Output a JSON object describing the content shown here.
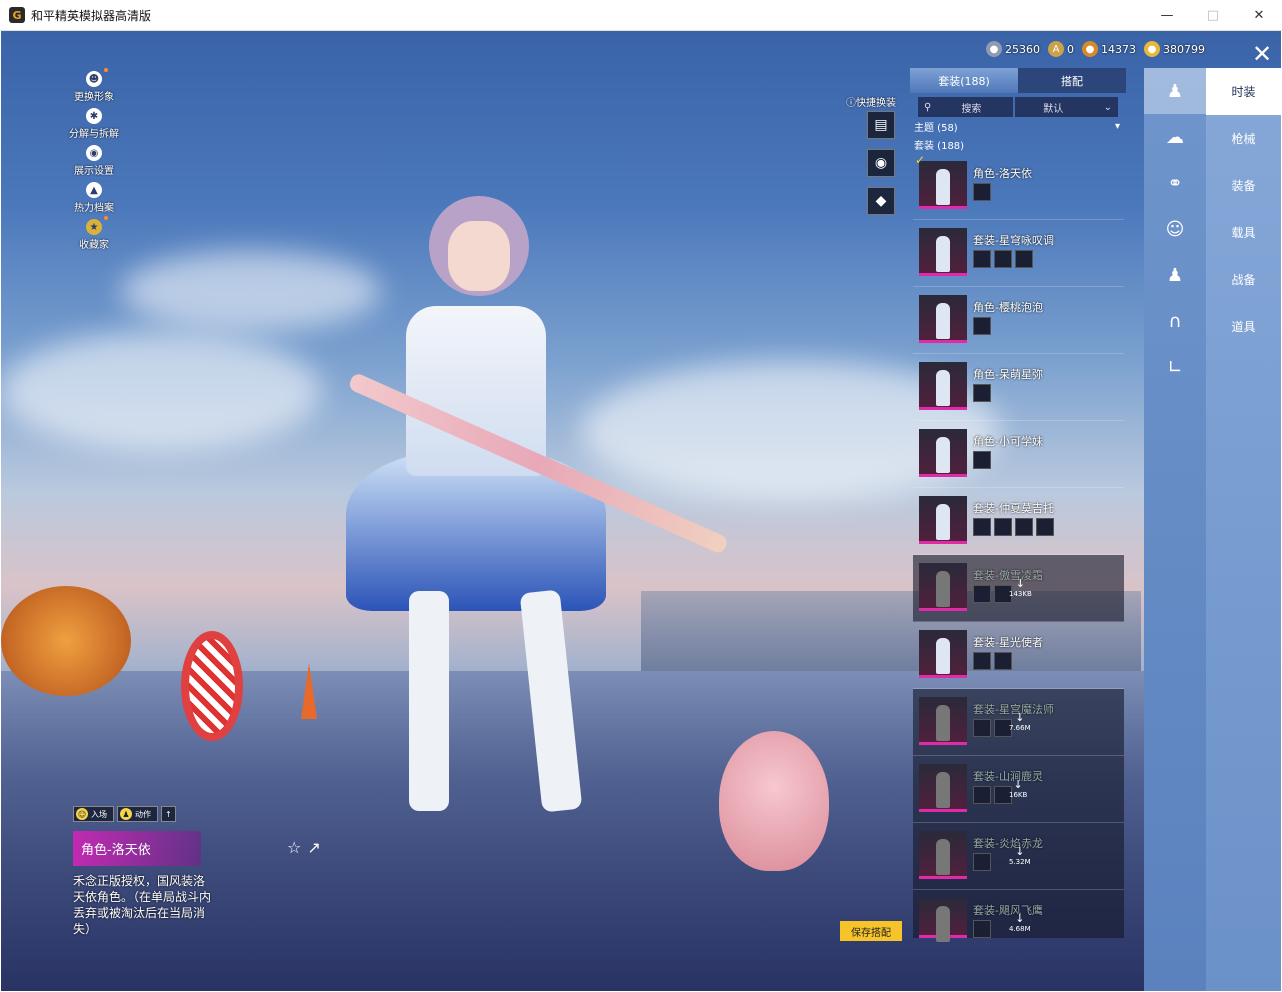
{
  "window": {
    "title": "和平精英模拟器高清版",
    "app_icon": "G"
  },
  "left_menu": [
    {
      "label": "更换形象",
      "icon": "person-icon"
    },
    {
      "label": "分解与拆解",
      "icon": "puzzle-icon"
    },
    {
      "label": "展示设置",
      "icon": "eye-icon"
    },
    {
      "label": "热力档案",
      "icon": "flame-icon"
    },
    {
      "label": "收藏家",
      "icon": "badge-icon"
    }
  ],
  "currency": [
    {
      "value": "25360",
      "color": "#8f9bb0"
    },
    {
      "value": "0",
      "color": "#c9a24a"
    },
    {
      "value": "14373",
      "color": "#d88a2a"
    },
    {
      "value": "380799",
      "color": "#e8b838"
    }
  ],
  "quick_swap_label": "快捷换装",
  "list": {
    "tabs": [
      "套装(188)",
      "搭配"
    ],
    "search_label": "搜索",
    "sort_label": "默认",
    "theme_label": "主题 (58)",
    "set_label": "套装 (188)",
    "items": [
      {
        "name": "角色-洛天依",
        "parts": 1,
        "dim": false,
        "selected": true
      },
      {
        "name": "套装-星穹咏叹调",
        "parts": 3,
        "dim": false
      },
      {
        "name": "角色-樱桃泡泡",
        "parts": 1,
        "dim": false
      },
      {
        "name": "角色-呆萌星弥",
        "parts": 1,
        "dim": false
      },
      {
        "name": "角色-小可学妹",
        "parts": 1,
        "dim": false
      },
      {
        "name": "套装-仲夏莫吉托",
        "parts": 4,
        "dim": false
      },
      {
        "name": "套装-傲雪凌霜",
        "parts": 2,
        "dim": true,
        "size": "143KB"
      },
      {
        "name": "套装-星光使者",
        "parts": 2,
        "dim": false
      },
      {
        "name": "套装-星宫魔法师",
        "parts": 2,
        "dim": true,
        "size": "7.66M"
      },
      {
        "name": "套装-山涧鹿灵",
        "parts": 2,
        "dim": true,
        "size": "16KB"
      },
      {
        "name": "套装-炎焰赤龙",
        "parts": 1,
        "dim": true,
        "size": "5.32M"
      },
      {
        "name": "套装-飓风飞鹰",
        "parts": 1,
        "dim": true,
        "size": "4.68M"
      }
    ]
  },
  "category_icons": [
    "outfit-icon",
    "cap-icon",
    "goggles-icon",
    "mask-icon",
    "figure-icon",
    "pants-icon",
    "socks-icon"
  ],
  "side_tabs": [
    "时装",
    "枪械",
    "装备",
    "载具",
    "战备",
    "道具"
  ],
  "detail": {
    "chip_enter": "入场",
    "chip_action": "动作",
    "title": "角色-洛天依",
    "description": "禾念正版授权，国风装洛天依角色。（在单局战斗内丢弃或被淘汰后在当局消失）"
  },
  "save_button": "保存搭配"
}
